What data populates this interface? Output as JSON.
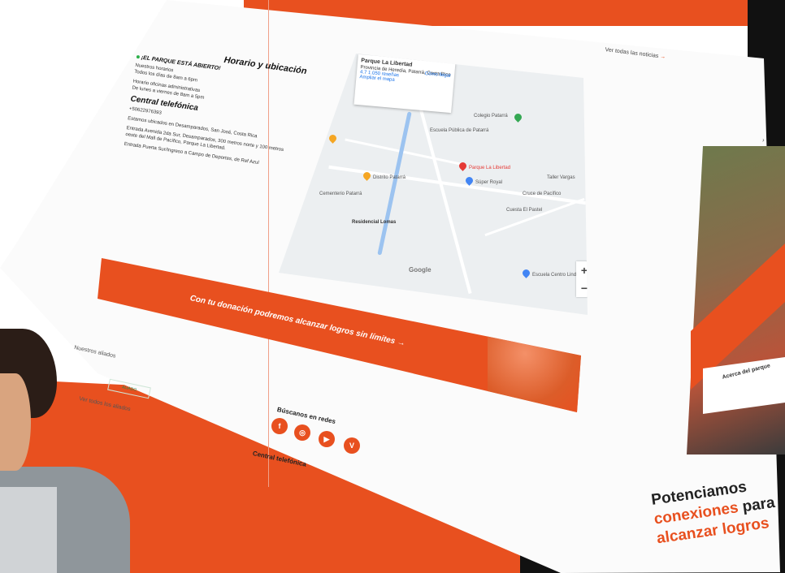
{
  "hours": {
    "title": "Horario y ubicación",
    "status": "¡EL PARQUE ESTÁ ABIERTO!",
    "schedule_label": "Nuestros horarios",
    "schedule_value": "Todos los días de 8am a 6pm",
    "office_hours": "Horario oficinas administrativas",
    "office_value": "De lunes a viernes de 8am a 5pm"
  },
  "phone": {
    "title": "Central telefónica",
    "number": "+50622976393"
  },
  "location": {
    "address": "Estamos ubicados en Desamparados, San José, Costa Rica",
    "directions": "Entrada Avenida 2da Sur, Desamparados, 300 metros norte y 100 metros oeste del Mall de Pacífico, Parque La Libertad.",
    "directions2": "Entrada Puerta Sur/Ingreso a Campo de Deportes, de Ref Azul"
  },
  "map": {
    "place_name": "Parque La Libertad",
    "place_addr": "Provincia de Heredia, Patarrá, Costa Rica",
    "directions_link": "Cómo llegar",
    "rating": "4.7",
    "reviews": "1.050 reseñas",
    "bigger_map": "Ampliar el mapa",
    "labels": [
      "Parque La Libertad",
      "Súper Royal",
      "Colegio Patarrá",
      "Escuela Pública de Patarrá",
      "Distrito Patarrá",
      "Cementerio Patarrá",
      "Residencial Lomas",
      "Cuesta El Pastel",
      "Taller Vargas",
      "Cruce de Pacífico",
      "Escuela Centro Linda Vista"
    ],
    "zoom_in": "+",
    "zoom_out": "−",
    "google": "Google"
  },
  "news": {
    "see_all": "Ver todas las noticias",
    "arrow": "→"
  },
  "donation": {
    "text": "Con tu donación podremos alcanzar logros sin límites",
    "arrow": "→"
  },
  "allies": {
    "title": "Nuestros aliados",
    "logo": "ALIADO",
    "see_all": "Ver todos los aliados",
    "arrow": "→"
  },
  "social": {
    "title": "Búscanos en redes",
    "icons": [
      "f",
      "◎",
      "▶",
      "V"
    ]
  },
  "footer": {
    "central": "Central telefónica"
  },
  "right_panel": {
    "card_label": "Acerca del parque",
    "chevron": "›"
  },
  "slogan": {
    "line1": "Potenciamos",
    "line2a": "conexiones",
    "line2b": "para",
    "line3": "alcanzar logros"
  },
  "colors": {
    "accent": "#e8501f",
    "dark": "#111111",
    "pin_red": "#e53935",
    "pin_blue": "#4285f4",
    "pin_green": "#34a853",
    "pin_orange": "#f5a623"
  }
}
